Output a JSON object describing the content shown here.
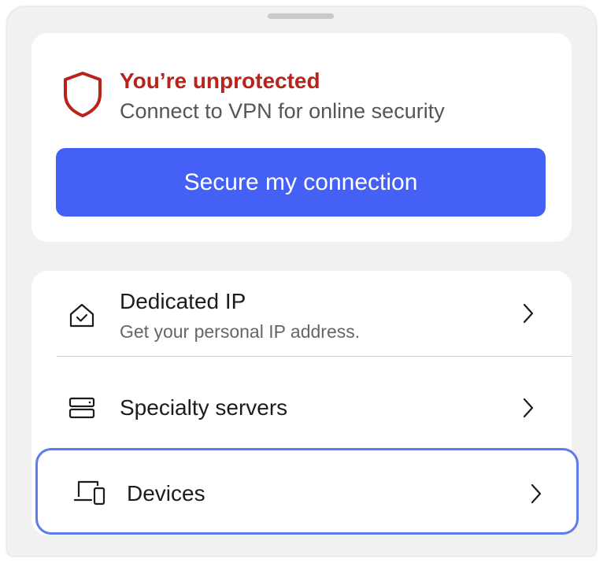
{
  "status": {
    "icon": "shield-icon",
    "title": "You’re unprotected",
    "subtitle": "Connect to VPN for online security",
    "title_color": "#b8231b"
  },
  "cta": {
    "label": "Secure my connection",
    "color": "#4561f5"
  },
  "menu": {
    "items": [
      {
        "title": "Dedicated IP",
        "subtitle": "Get your personal IP address.",
        "icon": "home-check-icon"
      },
      {
        "title": "Specialty servers",
        "icon": "server-icon"
      },
      {
        "title": "Devices",
        "icon": "devices-icon",
        "focused": true
      }
    ]
  },
  "focus_color": "#5c7cf0"
}
